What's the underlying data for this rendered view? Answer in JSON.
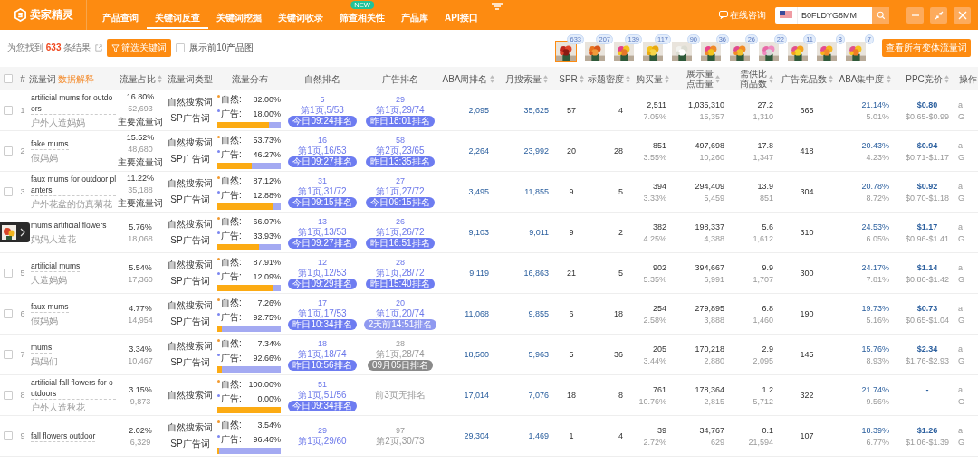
{
  "app": {
    "logo": "卖家精灵"
  },
  "nav": [
    {
      "label": "产品查询",
      "selected": false
    },
    {
      "label": "关键词反查",
      "selected": true
    },
    {
      "label": "关键词挖掘",
      "selected": false
    },
    {
      "label": "关键词收录",
      "selected": false
    },
    {
      "label": "筛查相关性",
      "selected": false,
      "badge": "NEW"
    },
    {
      "label": "产品库",
      "selected": false
    },
    {
      "label": "API接口",
      "selected": false
    }
  ],
  "consult": "在线咨询",
  "search": {
    "value": "B0FLDYG8MM"
  },
  "summary": {
    "prefix": "为您找到",
    "count": "633",
    "suffix": "条结果"
  },
  "filter_button": "筛选关键词",
  "show_images": {
    "label": "展示前10产品图",
    "checked": false
  },
  "thumbs": [
    {
      "count": "633",
      "selected": true
    },
    {
      "count": "207",
      "selected": false
    },
    {
      "count": "139",
      "selected": false
    },
    {
      "count": "117",
      "selected": false
    },
    {
      "count": "90",
      "selected": false
    },
    {
      "count": "36",
      "selected": false
    },
    {
      "count": "26",
      "selected": false
    },
    {
      "count": "22",
      "selected": false
    },
    {
      "count": "11",
      "selected": false
    },
    {
      "count": "8",
      "selected": false
    },
    {
      "count": "7",
      "selected": false
    }
  ],
  "variants_button": "查看所有变体流量词",
  "table": {
    "columns": [
      {
        "label": "#",
        "sortable": false
      },
      {
        "label": "流量词",
        "note": "数据解释",
        "sortable": false
      },
      {
        "label": "流量占比",
        "sortable": true
      },
      {
        "label": "流量词类型",
        "sortable": false
      },
      {
        "label": "流量分布",
        "sortable": false
      },
      {
        "label": "自然排名",
        "sortable": false
      },
      {
        "label": "广告排名",
        "sortable": false
      },
      {
        "label": "ABA周排名",
        "sortable": true
      },
      {
        "label": "月搜索量",
        "sortable": true
      },
      {
        "label": "SPR",
        "sortable": true
      },
      {
        "label": "标题密度",
        "sortable": true
      },
      {
        "label": "购买量",
        "sortable": true
      },
      {
        "label": "展示量点击量",
        "sortable": true
      },
      {
        "label": "需供比商品数",
        "sortable": true
      },
      {
        "label": "广告竞品数",
        "sortable": true
      },
      {
        "label": "ABA集中度",
        "sortable": true
      },
      {
        "label": "PPC竞价",
        "sortable": true
      },
      {
        "label": "操作",
        "sortable": false
      }
    ],
    "header_checked": false,
    "rows": [
      {
        "checked": false,
        "no": "1",
        "keyword": "artificial mums for outdoors",
        "keyword_cn": "户外人造妈妈",
        "share": "16.80%",
        "share_count": "52,693",
        "main_word": "主要流量词",
        "types": [
          "自然搜索词",
          "SP广告词"
        ],
        "natural_label": "自然:",
        "natural_pct": "82.00%",
        "ad_label": "广告:",
        "ad_pct": "18.00%",
        "level": 0.82,
        "natural_rank": {
          "kind": "ranked",
          "rank": "5",
          "page": "第1页,5/53",
          "badge": "今日09:24排名",
          "color": "#6d7cf1",
          "faded": false
        },
        "ad_rank": {
          "kind": "ranked",
          "rank": "29",
          "page": "第1页,29/74",
          "badge": "昨日18:01排名",
          "color": "#6d7cf1",
          "faded": false
        },
        "aba_rank": "2,095",
        "monthly": "35,625",
        "spr": "57",
        "title_density": "4",
        "purchases": "2,511",
        "purchase_rate": "7.05%",
        "impressions": "1,035,310",
        "clicks": "15,357",
        "supply_ratio": "27.2",
        "products": "1,310",
        "ad_competitors": "665",
        "aba_conc": "21.14%",
        "aba_conc_sub": "5.01%",
        "ppc": "$0.80",
        "ppc_range": "$0.65-$0.99",
        "actions": [
          "a",
          "G"
        ]
      },
      {
        "checked": false,
        "no": "2",
        "keyword": "fake mums",
        "keyword_cn": "假妈妈",
        "share": "15.52%",
        "share_count": "48,680",
        "main_word": "主要流量词",
        "types": [
          "自然搜索词",
          "SP广告词"
        ],
        "natural_label": "自然:",
        "natural_pct": "53.73%",
        "ad_label": "广告:",
        "ad_pct": "46.27%",
        "level": 0.5373,
        "natural_rank": {
          "kind": "ranked",
          "rank": "16",
          "page": "第1页,16/53",
          "badge": "今日09:27排名",
          "color": "#6d7cf1",
          "faded": false
        },
        "ad_rank": {
          "kind": "ranked",
          "rank": "58",
          "page": "第2页,23/65",
          "badge": "昨日13:35排名",
          "color": "#6d7cf1",
          "faded": false
        },
        "aba_rank": "2,264",
        "monthly": "23,992",
        "spr": "20",
        "title_density": "28",
        "purchases": "851",
        "purchase_rate": "3.55%",
        "impressions": "497,698",
        "clicks": "10,260",
        "supply_ratio": "17.8",
        "products": "1,347",
        "ad_competitors": "418",
        "aba_conc": "20.43%",
        "aba_conc_sub": "4.23%",
        "ppc": "$0.94",
        "ppc_range": "$0.71-$1.17",
        "actions": [
          "a",
          "G"
        ]
      },
      {
        "checked": false,
        "no": "3",
        "keyword": "faux mums for outdoor planters",
        "keyword_cn": "户外花盆的仿真菊花",
        "share": "11.22%",
        "share_count": "35,188",
        "main_word": "主要流量词",
        "types": [
          "自然搜索词",
          "SP广告词"
        ],
        "natural_label": "自然:",
        "natural_pct": "87.12%",
        "ad_label": "广告:",
        "ad_pct": "12.88%",
        "level": 0.8712,
        "natural_rank": {
          "kind": "ranked",
          "rank": "31",
          "page": "第1页,31/72",
          "badge": "今日09:15排名",
          "color": "#6d7cf1",
          "faded": false
        },
        "ad_rank": {
          "kind": "ranked",
          "rank": "27",
          "page": "第1页,27/72",
          "badge": "今日09:15排名",
          "color": "#6d7cf1",
          "faded": false
        },
        "aba_rank": "3,495",
        "monthly": "11,855",
        "spr": "9",
        "title_density": "5",
        "purchases": "394",
        "purchase_rate": "3.33%",
        "impressions": "294,409",
        "clicks": "5,459",
        "supply_ratio": "13.9",
        "products": "851",
        "ad_competitors": "304",
        "aba_conc": "20.78%",
        "aba_conc_sub": "8.72%",
        "ppc": "$0.92",
        "ppc_range": "$0.70-$1.18",
        "actions": [
          "a",
          "G"
        ]
      },
      {
        "keyword": "mums artificial flowers",
        "keyword_cn": "妈妈人造花",
        "share": "5.76%",
        "share_count": "18,068",
        "types": [
          "自然搜索词",
          "SP广告词"
        ],
        "natural_label": "自然:",
        "natural_pct": "66.07%",
        "ad_label": "广告:",
        "ad_pct": "33.93%",
        "level": 0.6607,
        "natural_rank": {
          "kind": "ranked",
          "rank": "13",
          "page": "第1页,13/53",
          "badge": "今日09:27排名",
          "color": "#6d7cf1",
          "faded": false
        },
        "ad_rank": {
          "kind": "ranked",
          "rank": "26",
          "page": "第1页,26/72",
          "badge": "昨日16:51排名",
          "color": "#6d7cf1",
          "faded": false
        },
        "aba_rank": "9,103",
        "monthly": "9,011",
        "spr": "9",
        "title_density": "2",
        "purchases": "382",
        "purchase_rate": "4.25%",
        "impressions": "198,337",
        "clicks": "4,388",
        "supply_ratio": "5.6",
        "products": "1,612",
        "ad_competitors": "310",
        "aba_conc": "24.53%",
        "aba_conc_sub": "6.05%",
        "ppc": "$1.17",
        "ppc_range": "$0.96-$1.41",
        "actions": [
          "a",
          "G"
        ]
      },
      {
        "checked": false,
        "no": "5",
        "keyword": "artificial mums",
        "keyword_cn": "人造妈妈",
        "share": "5.54%",
        "share_count": "17,360",
        "types": [
          "自然搜索词",
          "SP广告词"
        ],
        "natural_label": "自然:",
        "natural_pct": "87.91%",
        "ad_label": "广告:",
        "ad_pct": "12.09%",
        "level": 0.8791,
        "natural_rank": {
          "kind": "ranked",
          "rank": "12",
          "page": "第1页,12/53",
          "badge": "今日09:29排名",
          "color": "#6d7cf1",
          "faded": false
        },
        "ad_rank": {
          "kind": "ranked",
          "rank": "28",
          "page": "第1页,28/72",
          "badge": "昨日15:40排名",
          "color": "#6d7cf1",
          "faded": false
        },
        "aba_rank": "9,119",
        "monthly": "16,863",
        "spr": "21",
        "title_density": "5",
        "purchases": "902",
        "purchase_rate": "5.35%",
        "impressions": "394,667",
        "clicks": "6,991",
        "supply_ratio": "9.9",
        "products": "1,707",
        "ad_competitors": "300",
        "aba_conc": "24.17%",
        "aba_conc_sub": "7.81%",
        "ppc": "$1.14",
        "ppc_range": "$0.86-$1.42",
        "actions": [
          "a",
          "G"
        ]
      },
      {
        "checked": false,
        "no": "6",
        "keyword": "faux mums",
        "keyword_cn": "假妈妈",
        "share": "4.77%",
        "share_count": "14,954",
        "types": [
          "自然搜索词",
          "SP广告词"
        ],
        "natural_label": "自然:",
        "natural_pct": "7.26%",
        "ad_label": "广告:",
        "ad_pct": "92.75%",
        "level": 0.0726,
        "natural_rank": {
          "kind": "ranked",
          "rank": "17",
          "page": "第1页,17/53",
          "badge": "昨日10:34排名",
          "color": "#6d7cf1",
          "faded": false
        },
        "ad_rank": {
          "kind": "ranked",
          "rank": "20",
          "page": "第1页,20/74",
          "badge": "2天前14:51排名",
          "color": "#8f99f0",
          "faded": false
        },
        "aba_rank": "11,068",
        "monthly": "9,855",
        "spr": "6",
        "title_density": "18",
        "purchases": "254",
        "purchase_rate": "2.58%",
        "impressions": "279,895",
        "clicks": "3,888",
        "supply_ratio": "6.8",
        "products": "1,460",
        "ad_competitors": "190",
        "aba_conc": "19.73%",
        "aba_conc_sub": "5.16%",
        "ppc": "$0.73",
        "ppc_range": "$0.65-$1.04",
        "actions": [
          "a",
          "G"
        ]
      },
      {
        "checked": false,
        "no": "7",
        "keyword": "mums",
        "keyword_cn": "妈妈们",
        "share": "3.34%",
        "share_count": "10,467",
        "types": [
          "自然搜索词",
          "SP广告词"
        ],
        "natural_label": "自然:",
        "natural_pct": "7.34%",
        "ad_label": "广告:",
        "ad_pct": "92.66%",
        "level": 0.0734,
        "natural_rank": {
          "kind": "ranked",
          "rank": "18",
          "page": "第1页,18/74",
          "badge": "昨日10:56排名",
          "color": "#6d7cf1",
          "faded": false
        },
        "ad_rank": {
          "kind": "ranked",
          "rank": "28",
          "page": "第1页,28/74",
          "badge": "09月05日排名",
          "color": "#8a8a8a",
          "faded": true
        },
        "aba_rank": "18,500",
        "monthly": "5,963",
        "spr": "5",
        "title_density": "36",
        "purchases": "205",
        "purchase_rate": "3.44%",
        "impressions": "170,218",
        "clicks": "2,880",
        "supply_ratio": "2.9",
        "products": "2,095",
        "ad_competitors": "145",
        "aba_conc": "15.76%",
        "aba_conc_sub": "8.93%",
        "ppc": "$2.34",
        "ppc_range": "$1.76-$2.93",
        "actions": [
          "a",
          "G"
        ]
      },
      {
        "checked": false,
        "no": "8",
        "keyword": "artificial fall flowers for outdoors",
        "keyword_cn": "户外人造秋花",
        "share": "3.15%",
        "share_count": "9,873",
        "types": [
          "自然搜索词"
        ],
        "natural_label": "自然:",
        "natural_pct": "100.00%",
        "ad_label": "广告:",
        "ad_pct": "0.00%",
        "level": 1.0,
        "natural_rank": {
          "kind": "ranked",
          "rank": "51",
          "page": "第1页,51/56",
          "badge": "今日09:34排名",
          "color": "#6d7cf1",
          "faded": false
        },
        "ad_rank": {
          "kind": "none",
          "text": "前3页无排名"
        },
        "aba_rank": "17,014",
        "monthly": "7,076",
        "spr": "18",
        "title_density": "8",
        "purchases": "761",
        "purchase_rate": "10.76%",
        "impressions": "178,364",
        "clicks": "2,815",
        "supply_ratio": "1.2",
        "products": "5,712",
        "ad_competitors": "322",
        "aba_conc": "21.74%",
        "aba_conc_sub": "9.56%",
        "ppc": "-",
        "ppc_range": "-",
        "actions": [
          "a",
          "G"
        ]
      },
      {
        "checked": false,
        "no": "9",
        "keyword": "fall flowers outdoor",
        "share": "2.02%",
        "share_count": "6,329",
        "types": [
          "自然搜索词",
          "SP广告词"
        ],
        "natural_label": "自然:",
        "natural_pct": "3.54%",
        "ad_label": "广告:",
        "ad_pct": "96.46%",
        "level": 0.0354,
        "natural_rank": {
          "kind": "ranked",
          "rank": "29",
          "page": "第1页,29/60",
          "faded": false
        },
        "ad_rank": {
          "kind": "ranked",
          "rank": "97",
          "page": "第2页,30/73",
          "faded": true
        },
        "aba_rank": "29,304",
        "monthly": "1,469",
        "spr": "1",
        "title_density": "4",
        "purchases": "39",
        "purchase_rate": "2.72%",
        "impressions": "34,767",
        "clicks": "629",
        "supply_ratio": "0.1",
        "products": "21,594",
        "ad_competitors": "107",
        "aba_conc": "18.39%",
        "aba_conc_sub": "6.77%",
        "ppc": "$1.26",
        "ppc_range": "$1.06-$1.39",
        "actions": [
          "a",
          "G"
        ]
      }
    ]
  }
}
